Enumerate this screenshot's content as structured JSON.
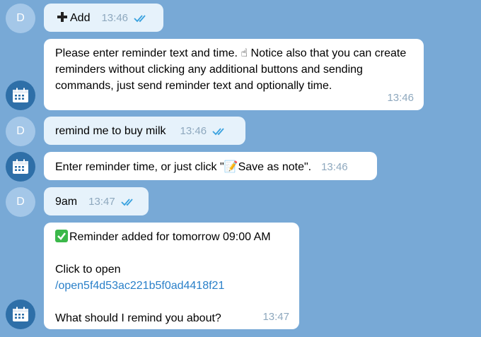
{
  "colors": {
    "background": "#78a9d6",
    "outgoing_bubble": "#e6f2fb",
    "incoming_bubble": "#ffffff",
    "link": "#2a80c9",
    "tick": "#3aa2df",
    "check_green": "#3bb84a"
  },
  "user_avatar_letter": "D",
  "messages": [
    {
      "text": "Add",
      "time": "13:46"
    },
    {
      "text": "Please enter reminder text and time. ☝ Notice also that you can create reminders without clicking any additional buttons and sending commands, just send reminder text and optionally time.",
      "time": "13:46"
    },
    {
      "text": "remind me to buy milk",
      "time": "13:46"
    },
    {
      "text_before": "Enter reminder time, or just click \"",
      "note_icon": "📝",
      "text_after": "Save as note\".",
      "time": "13:46"
    },
    {
      "text": "9am",
      "time": "13:47"
    },
    {
      "line1": "Reminder added for tomorrow 09:00 AM",
      "line2": "Click to open",
      "link": "/open5f4d53ac221b5f0ad4418f21",
      "line3": "What should I remind you about?",
      "time": "13:47"
    }
  ]
}
